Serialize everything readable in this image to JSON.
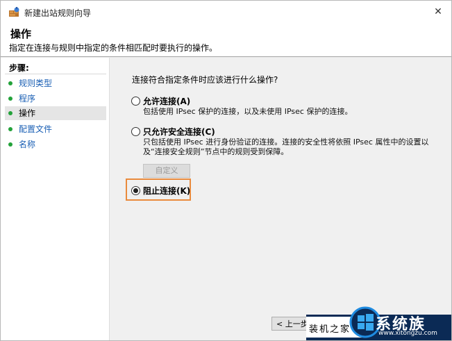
{
  "window": {
    "title": "新建出站规则向导",
    "close_glyph": "✕"
  },
  "header": {
    "title": "操作",
    "subtitle": "指定在连接与规则中指定的条件相匹配时要执行的操作。"
  },
  "steps": {
    "heading": "步骤:",
    "items": [
      {
        "label": "规则类型"
      },
      {
        "label": "程序"
      },
      {
        "label": "操作"
      },
      {
        "label": "配置文件"
      },
      {
        "label": "名称"
      }
    ],
    "active": "操作"
  },
  "main": {
    "question": "连接符合指定条件时应该进行什么操作?",
    "options": [
      {
        "label": "允许连接(A)",
        "desc": "包括使用 IPsec 保护的连接，以及未使用 IPsec 保护的连接。",
        "selected": false
      },
      {
        "label": "只允许安全连接(C)",
        "desc": "只包括使用 IPsec 进行身份验证的连接。连接的安全性将依照 IPsec 属性中的设置以及“连接安全规则”节点中的规则受到保障。",
        "selected": false
      },
      {
        "label": "阻止连接(K)",
        "desc": "",
        "selected": true
      }
    ],
    "customize_label": "自定义",
    "back_label": "< 上一步"
  },
  "watermark": {
    "text": "装机之家",
    "brand": "系统族",
    "url": "www.xitongzu.com"
  },
  "colors": {
    "accent_highlight": "#e98a3c",
    "step_bullet": "#23a23a",
    "link_text": "#1a5fb4",
    "watermark_bg": "#0b2a55"
  }
}
